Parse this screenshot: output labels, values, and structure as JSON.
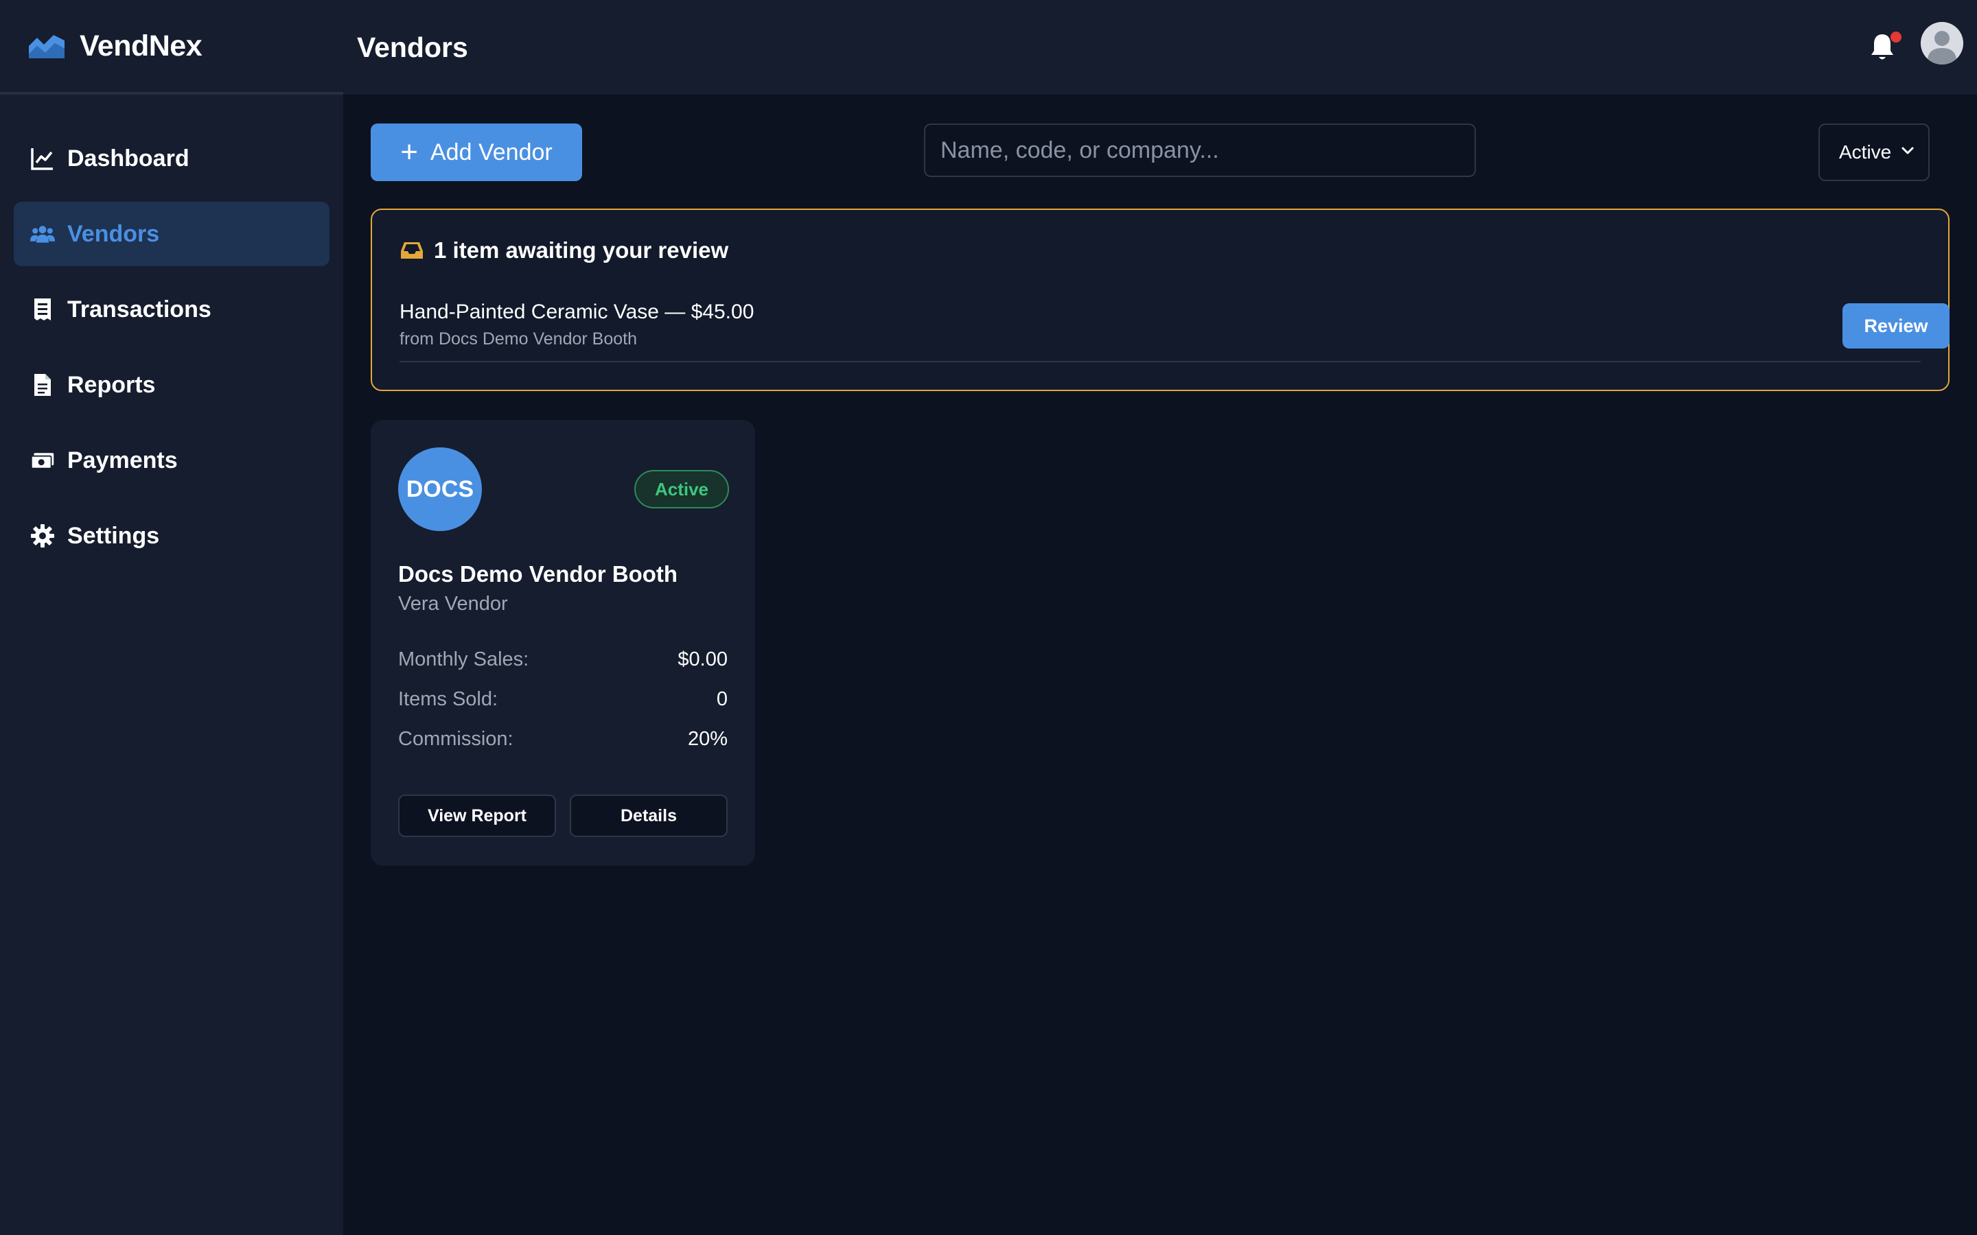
{
  "app": {
    "name": "VendNex",
    "logo_icon": "wave-logo-icon"
  },
  "sidebar": {
    "items": [
      {
        "label": "Dashboard",
        "icon": "chart-line-icon",
        "active": false
      },
      {
        "label": "Vendors",
        "icon": "users-icon",
        "active": true
      },
      {
        "label": "Transactions",
        "icon": "receipt-icon",
        "active": false
      },
      {
        "label": "Reports",
        "icon": "file-icon",
        "active": false
      },
      {
        "label": "Payments",
        "icon": "money-icon",
        "active": false
      },
      {
        "label": "Settings",
        "icon": "gear-icon",
        "active": false
      }
    ]
  },
  "header": {
    "title": "Vendors",
    "notification_icon": "bell-icon",
    "has_unread_notifications": true,
    "avatar_icon": "user-avatar-icon"
  },
  "toolbar": {
    "add_label": "Add Vendor",
    "search_placeholder": "Name, code, or company...",
    "search_value": "",
    "status_filter": "Active"
  },
  "review": {
    "title": "1 item awaiting your review",
    "icon": "inbox-icon",
    "items": [
      {
        "name": "Hand-Painted Ceramic Vase — $45.00",
        "from": "from Docs Demo Vendor Booth",
        "action_label": "Review"
      }
    ]
  },
  "vendors": [
    {
      "logo_text": "DOCS",
      "status": "Active",
      "name": "Docs Demo Vendor Booth",
      "contact": "Vera Vendor",
      "stats": [
        {
          "label": "Monthly Sales:",
          "value": "$0.00"
        },
        {
          "label": "Items Sold:",
          "value": "0"
        },
        {
          "label": "Commission:",
          "value": "20%"
        }
      ],
      "view_report_label": "View Report",
      "details_label": "Details"
    }
  ],
  "colors": {
    "accent": "#4a90e2",
    "sidebar_bg": "#151d2e",
    "main_bg": "#0c1220",
    "review_border": "#e3a73a",
    "status_green": "#3ec77f",
    "notification_dot": "#e53935"
  }
}
